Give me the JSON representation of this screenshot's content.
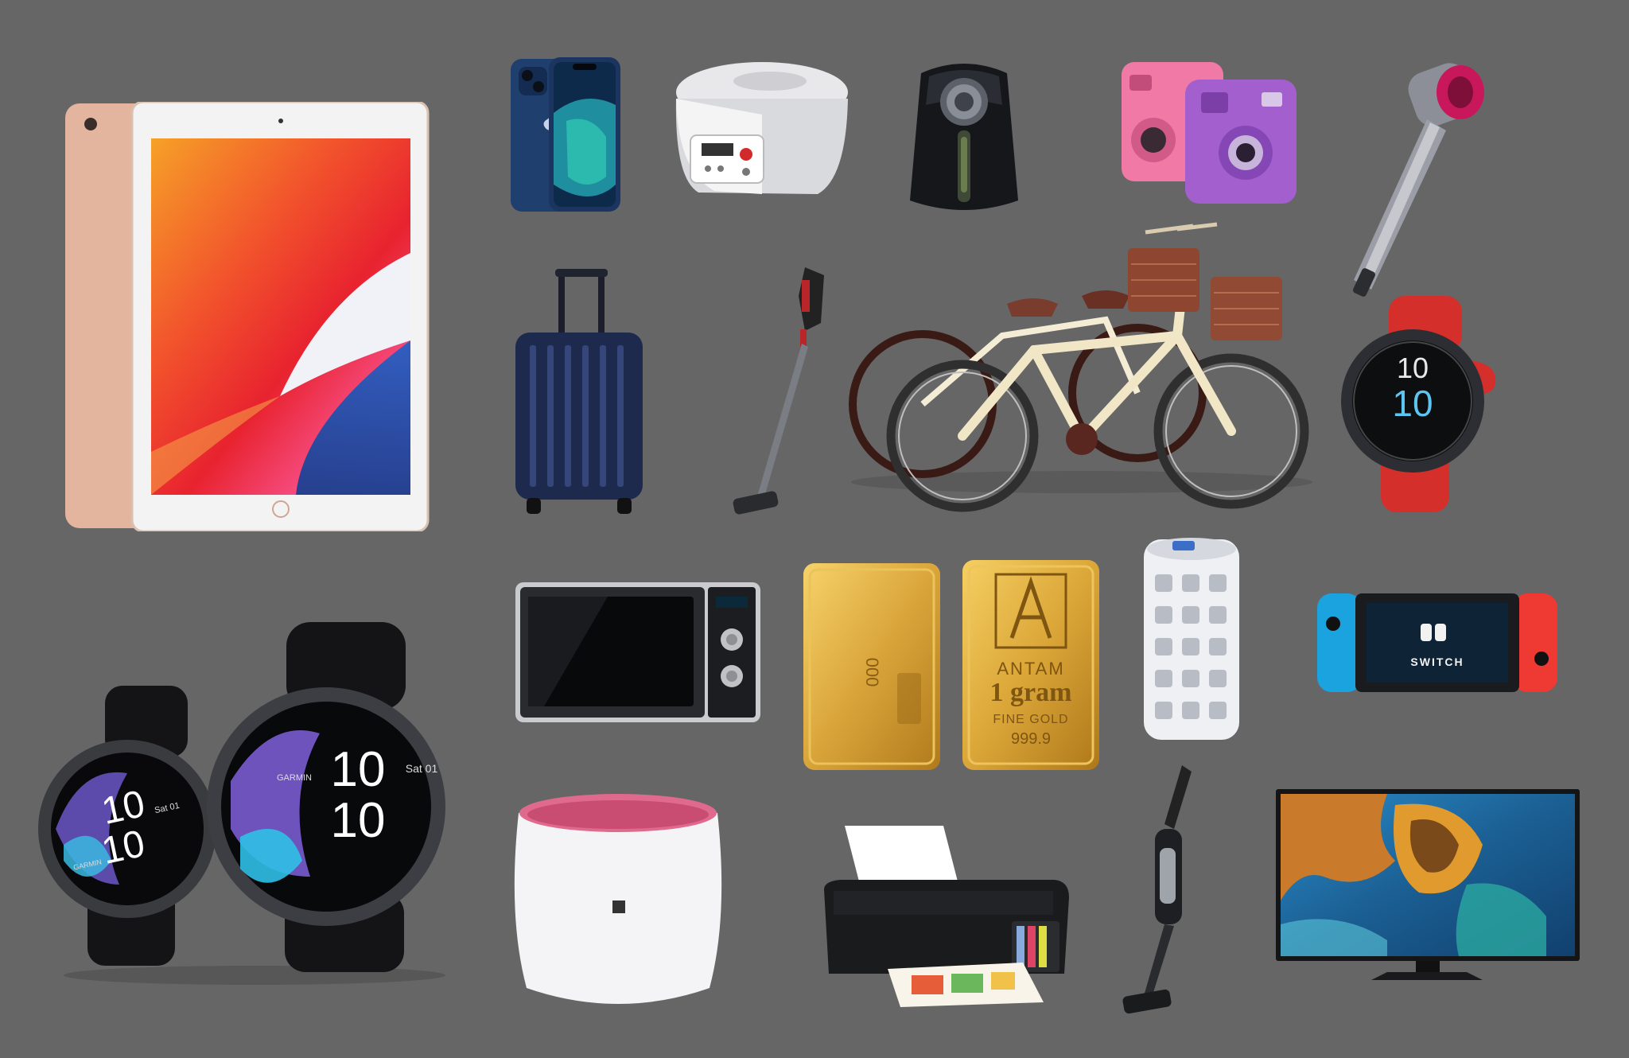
{
  "colors": {
    "background": "#666666",
    "tablet_gold": "#e9c3ac",
    "phone_blue": "#1f3f6e",
    "gold_bar": "#d9a53a",
    "watch_red": "#d42f2a",
    "switch_blue": "#1aa3df",
    "switch_red": "#ef3a33"
  },
  "smartwatch_large": {
    "hours": "10",
    "minutes": "10",
    "date": "Sat 01",
    "brand": "GARMIN"
  },
  "smartwatch_small": {
    "hours": "10",
    "minutes": "10",
    "date": "Sat 01",
    "brand": "GARMIN"
  },
  "fitness_watch": {
    "hours": "10",
    "minutes": "10"
  },
  "gold_bar_right": {
    "brand": "ANTAM",
    "weight": "1 gram",
    "purity_line": "FINE GOLD",
    "fineness": "999.9"
  },
  "gold_bar_left": {
    "serial": "000"
  },
  "game_console": {
    "label": "SWITCH"
  }
}
